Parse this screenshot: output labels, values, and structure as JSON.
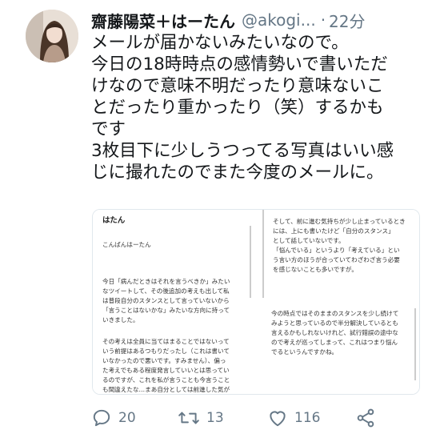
{
  "tweet": {
    "display_name": "齋藤陽菜＋はーたん",
    "handle": "@akogi...",
    "separator": "·",
    "time": "22分",
    "text_lines": [
      "メールが届かないみたいなので。",
      "今日の18時時点の感情勢いで書いただ",
      "けなので意味不明だったり意味ないこ",
      "とだったり重かったり（笑）するかも",
      "です",
      "3枚目下に少しうつってる写真はいい感",
      "じに撮れたのでまた今度のメールに。"
    ]
  },
  "media": {
    "left": {
      "title": "はたん",
      "greeting": "こんばんはーたん",
      "para1": [
        "今日「病んだときはそれを言うべきか」みたい",
        "なツイートして、その後追加の考えも出して私",
        "は普段自分のスタンスとして言っていないから",
        "「言うことはないかな」みたいな方向に持って",
        "いきました。"
      ],
      "para2": [
        "その考えは全員に当てはまることではないって",
        "いう前提はあるつもりだったし（これは書いて",
        "いなかったので悪いです。すみません）、偏っ",
        "た考えでもある程度発言していいとは思ってい",
        "るのですが、これを私が言うことも今言うこと",
        "も間違えたな…まあ自分としては前進した気が"
      ]
    },
    "right_top": [
      "そして、前に進む気持ちが少し止まっているとき",
      "には、上にも書いたけど「自分のスタンス」",
      "として話していないです。",
      "「悩んでいる」というより「考えている」とい",
      "う言い方のほうが合っていてわざわざ言う必要",
      "を感じないことも多いですが。"
    ],
    "right_bottom": [
      "今の時点ではそのままのスタンスを少し続けて",
      "みようと思っているので半分解決しているとも",
      "言えるかもしれないけれど、試行錯誤の途中な",
      "ので考えが巡ってしまって、これはつまり悩ん",
      "でるというんですかね。"
    ]
  },
  "actions": {
    "reply_count": "20",
    "retweet_count": "13",
    "like_count": "116"
  },
  "icons": {
    "reply": "reply-icon",
    "retweet": "retweet-icon",
    "like": "heart-icon",
    "share": "share-icon"
  },
  "colors": {
    "text": "#14171a",
    "secondary": "#657786",
    "border": "#e1e8ed"
  }
}
